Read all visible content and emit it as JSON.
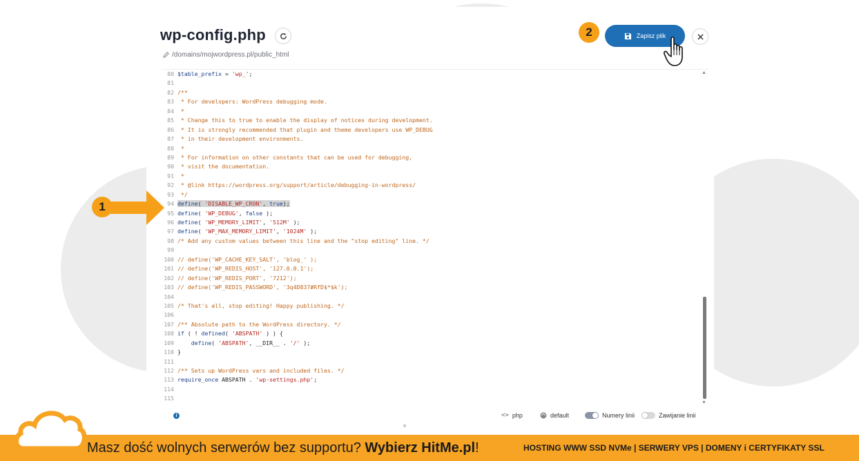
{
  "file": {
    "title": "wp-config.php",
    "path": "/domains/mojwordpress.pl/public_html"
  },
  "toolbar": {
    "save_label": "Zapisz plik"
  },
  "annotations": {
    "step1": "1",
    "step2": "2"
  },
  "code_lines": [
    {
      "n": "80",
      "t": "$table_prefix = 'wp_';"
    },
    {
      "n": "81",
      "t": ""
    },
    {
      "n": "82",
      "t": "/**"
    },
    {
      "n": "83",
      "t": " * For developers: WordPress debugging mode."
    },
    {
      "n": "84",
      "t": " *"
    },
    {
      "n": "85",
      "t": " * Change this to true to enable the display of notices during development."
    },
    {
      "n": "86",
      "t": " * It is strongly recommended that plugin and theme developers use WP_DEBUG"
    },
    {
      "n": "87",
      "t": " * in their development environments."
    },
    {
      "n": "88",
      "t": " *"
    },
    {
      "n": "89",
      "t": " * For information on other constants that can be used for debugging,"
    },
    {
      "n": "90",
      "t": " * visit the documentation."
    },
    {
      "n": "91",
      "t": " *"
    },
    {
      "n": "92",
      "t": " * @link https://wordpress.org/support/article/debugging-in-wordpress/"
    },
    {
      "n": "93",
      "t": " */"
    },
    {
      "n": "94",
      "t": "define( 'DISABLE_WP_CRON', true);"
    },
    {
      "n": "95",
      "t": "define( 'WP_DEBUG', false );"
    },
    {
      "n": "96",
      "t": "define( 'WP_MEMORY_LIMIT', '512M' );"
    },
    {
      "n": "97",
      "t": "define( 'WP_MAX_MEMORY_LIMIT', '1024M' );"
    },
    {
      "n": "98",
      "t": "/* Add any custom values between this line and the \"stop editing\" line. */"
    },
    {
      "n": "99",
      "t": ""
    },
    {
      "n": "100",
      "t": "// define('WP_CACHE_KEY_SALT', 'blog_' );"
    },
    {
      "n": "101",
      "t": "// define('WP_REDIS_HOST', '127.0.0.1');"
    },
    {
      "n": "102",
      "t": "// define('WP_REDIS_PORT', '7212');"
    },
    {
      "n": "103",
      "t": "// define('WP_REDIS_PASSWORD', '3q4D837#RfD$*$k');"
    },
    {
      "n": "104",
      "t": ""
    },
    {
      "n": "105",
      "t": "/* That's all, stop editing! Happy publishing. */"
    },
    {
      "n": "106",
      "t": ""
    },
    {
      "n": "107",
      "t": "/** Absolute path to the WordPress directory. */"
    },
    {
      "n": "108",
      "t": "if ( ! defined( 'ABSPATH' ) ) {"
    },
    {
      "n": "109",
      "t": "    define( 'ABSPATH', __DIR__ . '/' );"
    },
    {
      "n": "110",
      "t": "}"
    },
    {
      "n": "111",
      "t": ""
    },
    {
      "n": "112",
      "t": "/** Sets up WordPress vars and included files. */"
    },
    {
      "n": "113",
      "t": "require_once ABSPATH . 'wp-settings.php';"
    },
    {
      "n": "114",
      "t": ""
    },
    {
      "n": "115",
      "t": ""
    }
  ],
  "status_bar": {
    "info": "i",
    "language": "php",
    "theme": "default",
    "line_numbers_label": "Numery linii",
    "line_numbers_on": true,
    "word_wrap_label": "Zawijanie linii",
    "word_wrap_on": false
  },
  "footer": {
    "msg_start": "Masz dość wolnych serwerów bez supportu? ",
    "msg_brand": "Wybierz HitMe.pl",
    "msg_end": "!",
    "services": "HOSTING WWW SSD NVMe | SERWERY VPS | DOMENY i CERTYFIKATY SSL"
  },
  "colors": {
    "accent_blue": "#1e6fb5",
    "badge_orange": "#f6a01a",
    "footer_orange": "#f7a323"
  }
}
